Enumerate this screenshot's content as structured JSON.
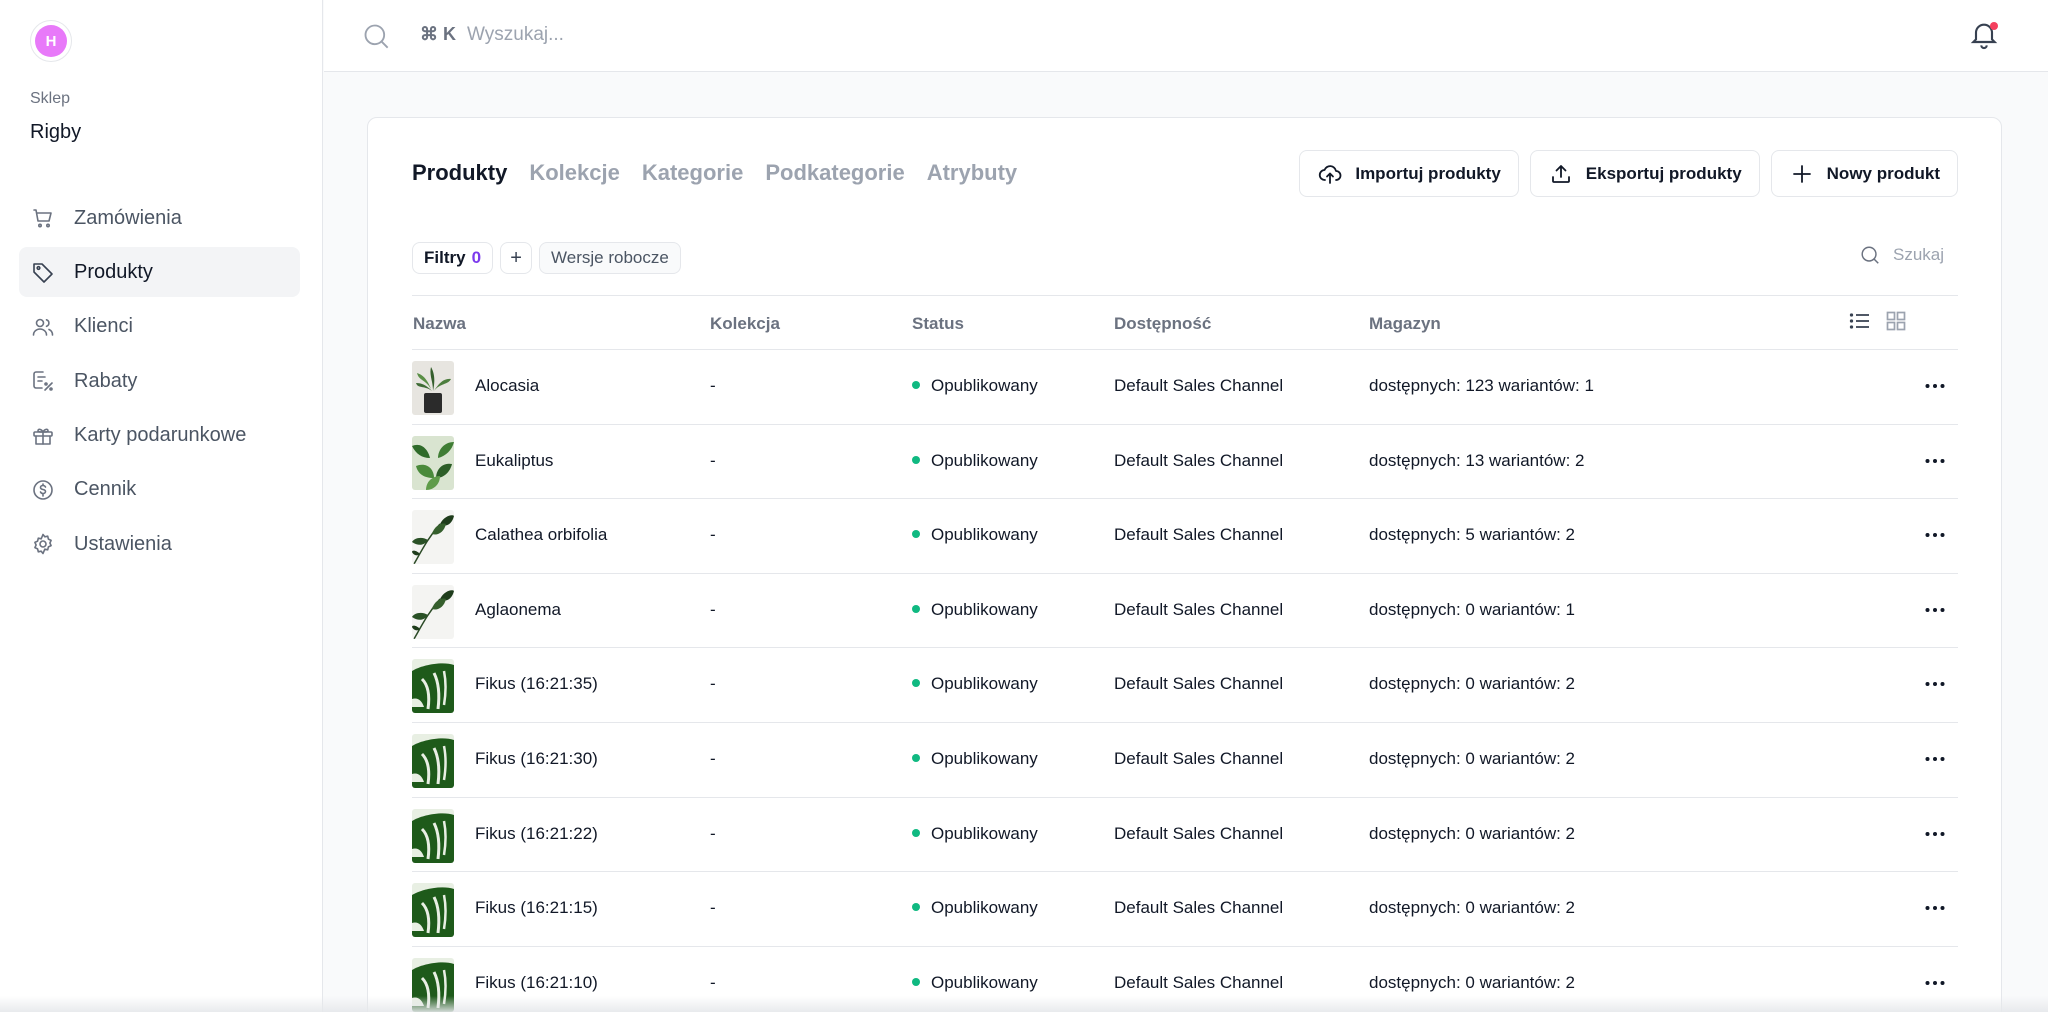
{
  "store": {
    "avatar_initial": "H",
    "label": "Sklep",
    "name": "Rigby"
  },
  "nav": [
    {
      "label": "Zamówienia",
      "icon": "cart-icon"
    },
    {
      "label": "Produkty",
      "icon": "tag-icon",
      "active": true
    },
    {
      "label": "Klienci",
      "icon": "users-icon"
    },
    {
      "label": "Rabaty",
      "icon": "receipt-percent-icon"
    },
    {
      "label": "Karty podarunkowe",
      "icon": "gift-icon"
    },
    {
      "label": "Cennik",
      "icon": "currency-icon"
    },
    {
      "label": "Ustawienia",
      "icon": "gear-icon"
    }
  ],
  "topbar": {
    "shortcut": "⌘ K",
    "search_placeholder": "Wyszukaj..."
  },
  "tabs": [
    "Produkty",
    "Kolekcje",
    "Kategorie",
    "Podkategorie",
    "Atrybuty"
  ],
  "actions": {
    "import": "Importuj produkty",
    "export": "Eksportuj produkty",
    "new": "Nowy produkt"
  },
  "filters": {
    "label": "Filtry",
    "count": "0",
    "add": "+",
    "drafts": "Wersje robocze"
  },
  "table_search_placeholder": "Szukaj",
  "columns": {
    "name": "Nazwa",
    "collection": "Kolekcja",
    "status": "Status",
    "availability": "Dostępność",
    "inventory": "Magazyn"
  },
  "colors": {
    "status_published": "#10b981",
    "filter_count": "#7c3aed",
    "bell_dot": "#f43f5e",
    "avatar": "#e879f9"
  },
  "rows": [
    {
      "name": "Alocasia",
      "collection": "-",
      "status": "Opublikowany",
      "availability": "Default Sales Channel",
      "inventory": "dostępnych: 123 wariantów: 1",
      "thumb": "pot"
    },
    {
      "name": "Eukaliptus",
      "collection": "-",
      "status": "Opublikowany",
      "availability": "Default Sales Channel",
      "inventory": "dostępnych: 13 wariantów: 2",
      "thumb": "leafy"
    },
    {
      "name": "Calathea orbifolia",
      "collection": "-",
      "status": "Opublikowany",
      "availability": "Default Sales Channel",
      "inventory": "dostępnych: 5 wariantów: 2",
      "thumb": "branch"
    },
    {
      "name": "Aglaonema",
      "collection": "-",
      "status": "Opublikowany",
      "availability": "Default Sales Channel",
      "inventory": "dostępnych: 0 wariantów: 1",
      "thumb": "branch"
    },
    {
      "name": "Fikus (16:21:35)",
      "collection": "-",
      "status": "Opublikowany",
      "availability": "Default Sales Channel",
      "inventory": "dostępnych: 0 wariantów: 2",
      "thumb": "monstera"
    },
    {
      "name": "Fikus (16:21:30)",
      "collection": "-",
      "status": "Opublikowany",
      "availability": "Default Sales Channel",
      "inventory": "dostępnych: 0 wariantów: 2",
      "thumb": "monstera"
    },
    {
      "name": "Fikus (16:21:22)",
      "collection": "-",
      "status": "Opublikowany",
      "availability": "Default Sales Channel",
      "inventory": "dostępnych: 0 wariantów: 2",
      "thumb": "monstera"
    },
    {
      "name": "Fikus (16:21:15)",
      "collection": "-",
      "status": "Opublikowany",
      "availability": "Default Sales Channel",
      "inventory": "dostępnych: 0 wariantów: 2",
      "thumb": "monstera"
    },
    {
      "name": "Fikus (16:21:10)",
      "collection": "-",
      "status": "Opublikowany",
      "availability": "Default Sales Channel",
      "inventory": "dostępnych: 0 wariantów: 2",
      "thumb": "monstera"
    }
  ]
}
